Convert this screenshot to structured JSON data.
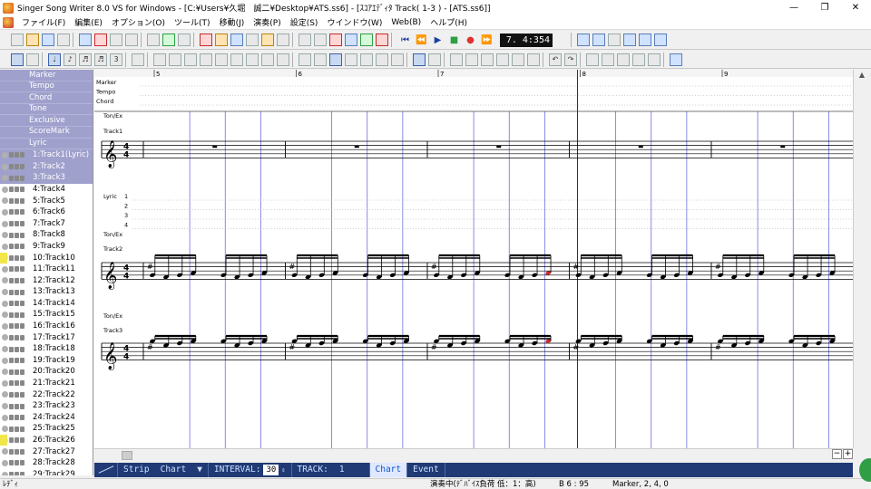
{
  "window": {
    "title": "Singer Song Writer 8.0 VS for Windows - [C:¥Users¥久堀　誠二¥Desktop¥ATS.ss6] - [ｽｺｱｴﾃﾞｨﾀ Track( 1-3 ) - [ATS.ss6]]",
    "controls": [
      "—",
      "❐",
      "✕"
    ]
  },
  "menu": [
    "ファイル(F)",
    "編集(E)",
    "オプション(O)",
    "ツール(T)",
    "移動(J)",
    "演奏(P)",
    "設定(S)",
    "ウインドウ(W)",
    "Web(B)",
    "ヘルプ(H)"
  ],
  "transport": {
    "time": "7. 4:354"
  },
  "tracklist": {
    "special": [
      "Marker",
      "Tempo",
      "Chord",
      "Tone",
      "Exclusive",
      "ScoreMark",
      "Lyric"
    ],
    "tracks": [
      "1:Track1(Lyric)",
      "2:Track2",
      "3:Track3",
      "4:Track4",
      "5:Track5",
      "6:Track6",
      "7:Track7",
      "8:Track8",
      "9:Track9",
      "10:Track10",
      "11:Track11",
      "12:Track12",
      "13:Track13",
      "14:Track14",
      "15:Track15",
      "16:Track16",
      "17:Track17",
      "18:Track18",
      "19:Track19",
      "20:Track20",
      "21:Track21",
      "22:Track22",
      "23:Track23",
      "24:Track24",
      "25:Track25",
      "26:Track26",
      "27:Track27",
      "28:Track28",
      "29:Track29"
    ],
    "selected": [
      0,
      1,
      2
    ],
    "yellow": [
      9,
      25
    ]
  },
  "score": {
    "measures": [
      "5",
      "6",
      "7",
      "8",
      "9"
    ],
    "header_rows": [
      "Marker",
      "Tempo",
      "Chord"
    ],
    "labels": {
      "tonex1": "Ton/Ex",
      "track1": "Track1",
      "lyric": "Lyric",
      "lyric_nums": [
        "1",
        "2",
        "3",
        "4"
      ],
      "tonex2": "Ton/Ex",
      "track2": "Track2",
      "tonex3": "Ton/Ex",
      "track3": "Track3"
    },
    "time_sig": "4/4",
    "accidental": "#"
  },
  "stripbar": {
    "mode1": "Strip",
    "mode2": "Chart",
    "dropdown": "▼",
    "interval_label": "INTERVAL:",
    "interval_value": "30",
    "track_label": "TRACK:",
    "track_value": "1",
    "view_chart": "Chart",
    "view_event": "Event"
  },
  "status": {
    "left": "ﾚﾃﾞｨ",
    "center": "演奏中(ﾃﾞﾊﾞｲｽ負荷 低：1：高)",
    "beat": "B 6 : 95",
    "marker": "Marker,  2, 4, 0"
  },
  "colors": {
    "selection": "#9fa0cc",
    "strip_bg": "#1f3a75",
    "beat_line": "#3d3dd6",
    "note_accent": "#c92a2a"
  }
}
